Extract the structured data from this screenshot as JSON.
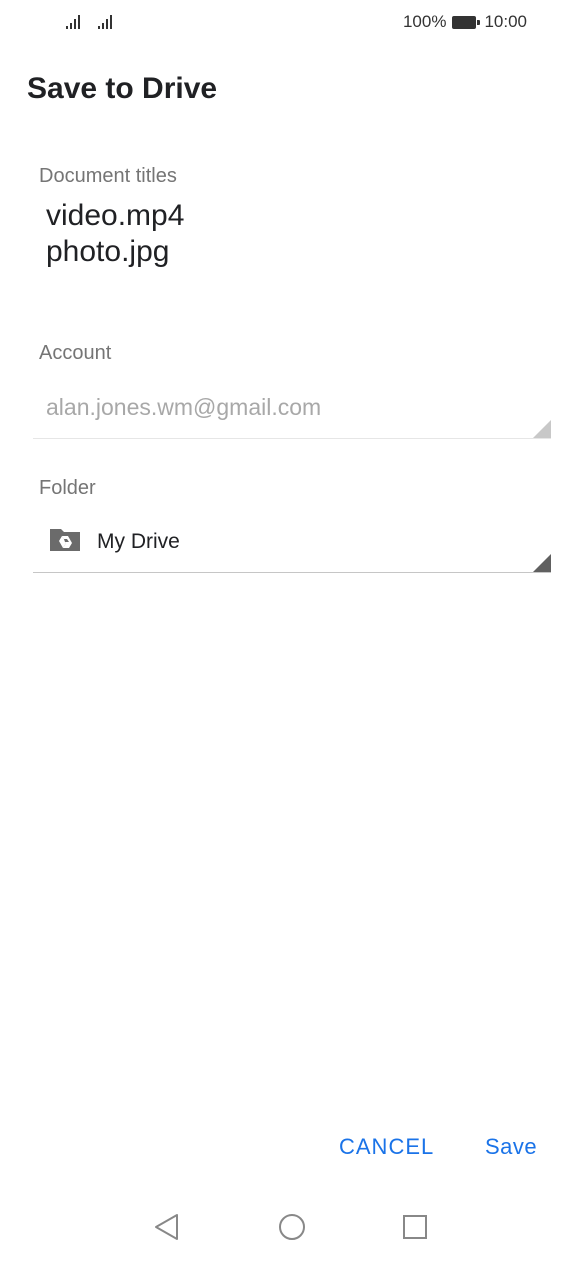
{
  "status_bar": {
    "battery": "100%",
    "time": "10:00",
    "icons": [
      "signal-icon",
      "signal-icon",
      "battery-icon"
    ]
  },
  "dialog": {
    "title": "Save to Drive",
    "document_titles_label": "Document titles",
    "documents": [
      "video.mp4",
      "photo.jpg"
    ],
    "account_label": "Account",
    "account_value": "alan.jones.wm@gmail.com",
    "folder_label": "Folder",
    "folder_value": "My Drive",
    "folder_icon": "drive-folder-icon"
  },
  "buttons": {
    "cancel": "CANCEL",
    "save": "Save"
  },
  "nav": {
    "icons": [
      "back-icon",
      "home-icon",
      "recents-icon"
    ]
  },
  "colors": {
    "accent": "#1a73e8",
    "label": "#757575",
    "disabled_text": "#a8a8a8"
  }
}
